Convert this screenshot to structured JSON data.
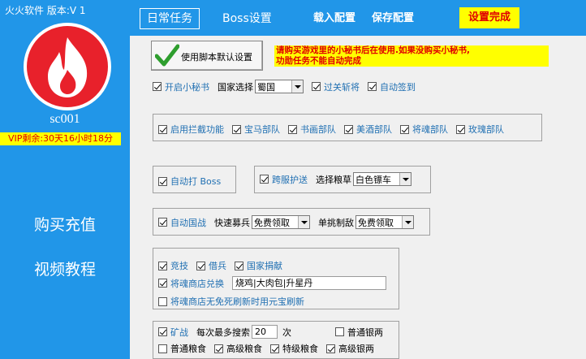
{
  "app": {
    "title": "火火软件 版本:V 1"
  },
  "sidebar": {
    "username": "sc001",
    "vip": "VIP剩余:30天16小时18分",
    "links": [
      "购买充值",
      "视频教程"
    ]
  },
  "tabs": {
    "daily": "日常任务",
    "boss": "Boss设置",
    "load": "载入配置",
    "save": "保存配置",
    "finish": "设置完成"
  },
  "main": {
    "default_button": "使用脚本默认设置",
    "notice_line1": "请购买游戏里的小秘书后在使用.如果没购买小秘书,",
    "notice_line2": "功勋任务不能自动完成",
    "row1": {
      "secretary": "开启小秘书",
      "country_label": "国家选择",
      "country_value": "蜀国",
      "pass_general": "过关斩将",
      "auto_sign": "自动签到"
    },
    "intercept": [
      "启用拦截功能",
      "宝马部队",
      "书画部队",
      "美酒部队",
      "将魂部队",
      "玫瑰部队"
    ],
    "auto_boss": "自动打 Boss",
    "cross_escort": "跨服护送",
    "grain_label": "选择粮草",
    "grain_value": "白色镖车",
    "auto_war": "自动国战",
    "recruit_label": "快速募兵",
    "recruit_value": "免费领取",
    "single_label": "单挑制敌",
    "single_value": "免费领取",
    "misc": [
      "竞技",
      "借兵",
      "国家捐献"
    ],
    "shop_exchange": "将魂商店兑换",
    "shop_items": "烧鸡|大肉包|升星丹",
    "shop_refresh": "将魂商店无免死刷新时用元宝刷新",
    "mine": "矿战",
    "search_label": "每次最多搜索",
    "search_value": "20",
    "search_unit": "次",
    "silver": [
      "普通银两",
      "高级银两"
    ],
    "grain_types": [
      "普通粮食",
      "高级粮食",
      "特级粮食"
    ]
  },
  "colors": {
    "sidebar": "#2196e8",
    "vip_bg": "#ffff00",
    "vip_text": "#e00000",
    "flame": "#e8212b"
  }
}
